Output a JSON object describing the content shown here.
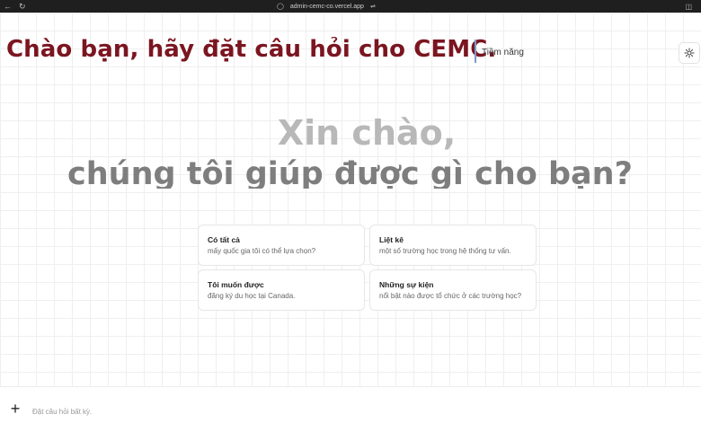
{
  "browser": {
    "url": "admin-cemc-co.vercel.app"
  },
  "header": {
    "title": "Chào bạn, hãy đặt câu hỏi cho CEMC.",
    "tab_label": "Tiềm năng"
  },
  "greeting": {
    "line1": "Xin chào,",
    "line2": "chúng tôi giúp được gì cho bạn?"
  },
  "suggestions": [
    {
      "title": "Có tất cả",
      "subtitle": "mấy quốc gia tôi có thể lựa chọn?"
    },
    {
      "title": "Liệt kê",
      "subtitle": "một số trường học trong hệ thống tư vấn."
    },
    {
      "title": "Tôi muốn được",
      "subtitle": "đăng ký du học tại Canada."
    },
    {
      "title": "Những sự kiện",
      "subtitle": "nổi bật nào được tổ chức ở các trường học?"
    }
  ],
  "composer": {
    "placeholder": "Đặt câu hỏi bất kỳ."
  },
  "colors": {
    "title": "#7b1520",
    "separator": "#7a9cc9",
    "greeting_light": "#b8b8b8",
    "greeting_dark": "#7e7e7e"
  },
  "icons": {
    "theme_toggle": "sun-icon",
    "add": "plus-icon"
  }
}
